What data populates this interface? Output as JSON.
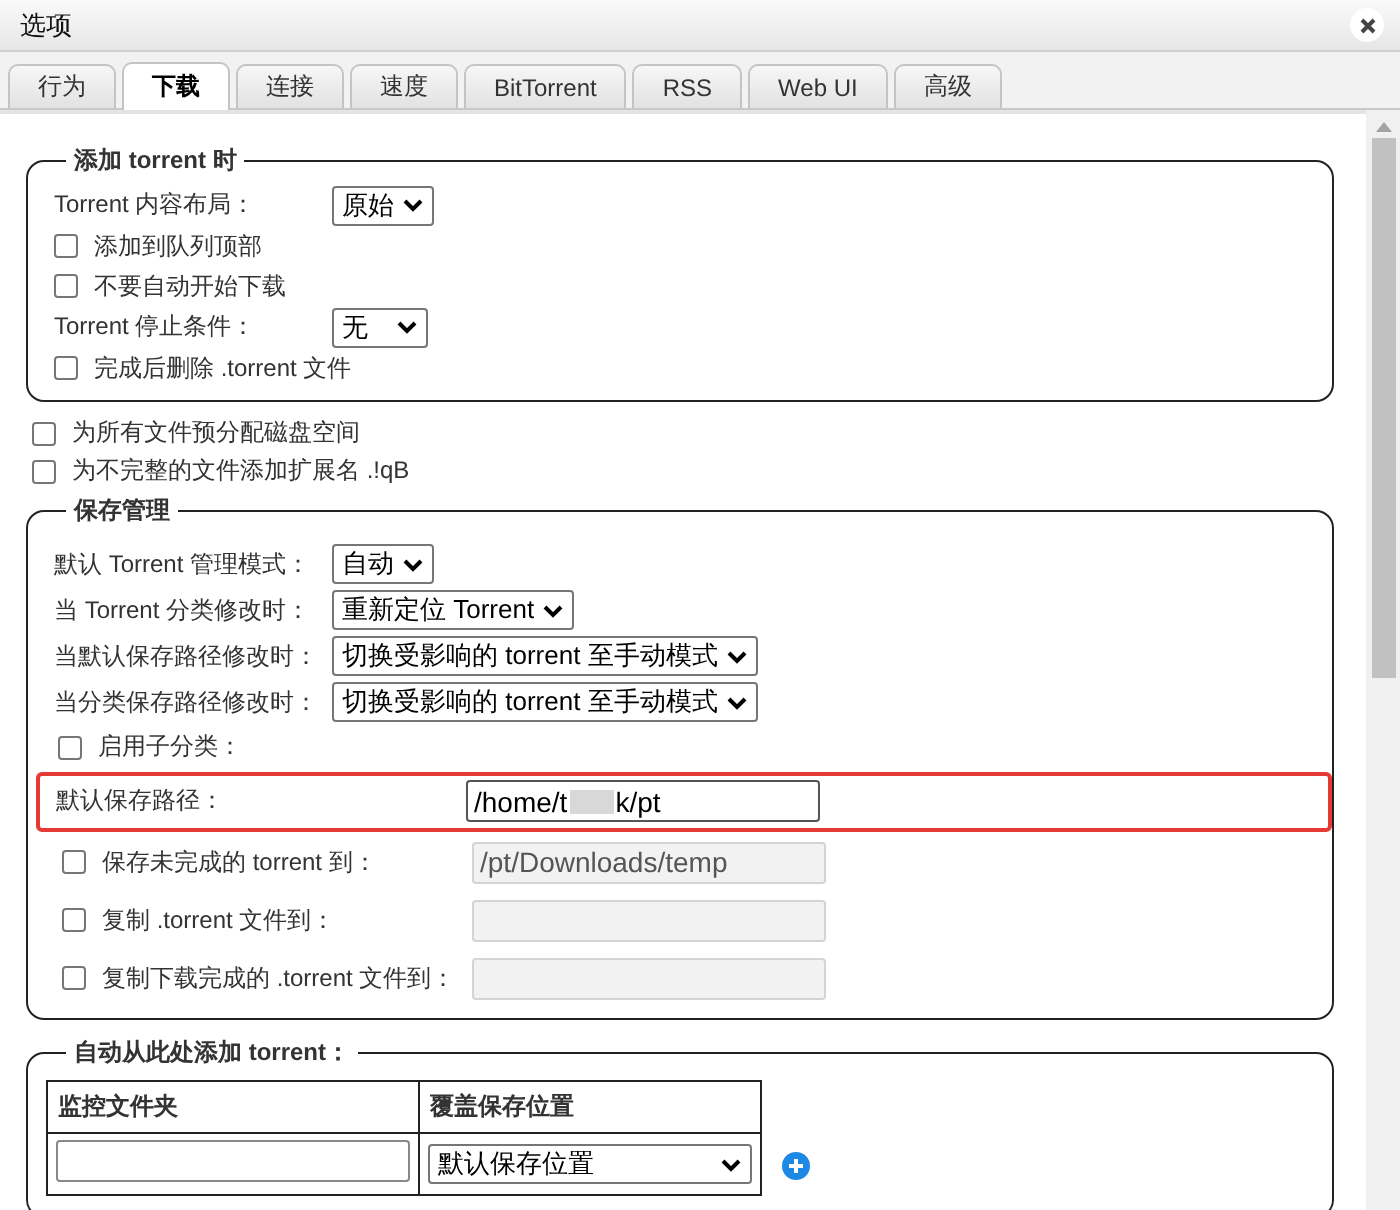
{
  "window": {
    "title": "选项"
  },
  "tabs": [
    {
      "label": "行为",
      "selected": false
    },
    {
      "label": "下载",
      "selected": true
    },
    {
      "label": "连接",
      "selected": false
    },
    {
      "label": "速度",
      "selected": false
    },
    {
      "label": "BitTorrent",
      "selected": false
    },
    {
      "label": "RSS",
      "selected": false
    },
    {
      "label": "Web UI",
      "selected": false
    },
    {
      "label": "高级",
      "selected": false
    }
  ],
  "sections": [
    {
      "kind": "group",
      "legend": "添加 torrent 时",
      "items": [
        {
          "kind": "select",
          "label": "Torrent 内容布局：",
          "value": "原始"
        },
        {
          "kind": "checkbox",
          "label": "添加到队列顶部",
          "checked": false
        },
        {
          "kind": "checkbox",
          "label": "不要自动开始下载",
          "checked": false
        },
        {
          "kind": "select",
          "label": "Torrent 停止条件：",
          "value": "无"
        },
        {
          "kind": "checkbox",
          "label": "完成后删除 .torrent 文件",
          "checked": false
        }
      ]
    },
    {
      "kind": "checkbox",
      "label": "为所有文件预分配磁盘空间",
      "checked": false
    },
    {
      "kind": "checkbox",
      "label": "为不完整的文件添加扩展名 .!qB",
      "checked": false
    },
    {
      "kind": "group",
      "legend": "保存管理",
      "items": [
        {
          "kind": "select",
          "label": "默认 Torrent 管理模式：",
          "value": "自动"
        },
        {
          "kind": "select",
          "label": "当 Torrent 分类修改时：",
          "value": "重新定位 Torrent"
        },
        {
          "kind": "select",
          "label": "当默认保存路径修改时：",
          "value": "切换受影响的 torrent 至手动模式"
        },
        {
          "kind": "select",
          "label": "当分类保存路径修改时：",
          "value": "切换受影响的 torrent 至手动模式"
        },
        {
          "kind": "checkbox",
          "label": "启用子分类：",
          "checked": false
        },
        {
          "kind": "path",
          "label": "默认保存路径：",
          "value_start": "/home/t",
          "value_end": "k/pt",
          "highlighted": true
        },
        {
          "kind": "checkpath",
          "label": "保存未完成的 torrent 到：",
          "checked": false,
          "disabled": true,
          "value": "/pt/Downloads/temp"
        },
        {
          "kind": "checkpath",
          "label": "复制 .torrent 文件到：",
          "checked": false,
          "disabled": true
        },
        {
          "kind": "checkpath",
          "label": "复制下载完成的 .torrent 文件到：",
          "checked": false,
          "disabled": true
        }
      ]
    },
    {
      "kind": "watch",
      "legend": "自动从此处添加 torrent：",
      "columns": [
        "监控文件夹",
        "覆盖保存位置"
      ],
      "rows": [
        {
          "location": "默认保存位置"
        }
      ]
    }
  ]
}
